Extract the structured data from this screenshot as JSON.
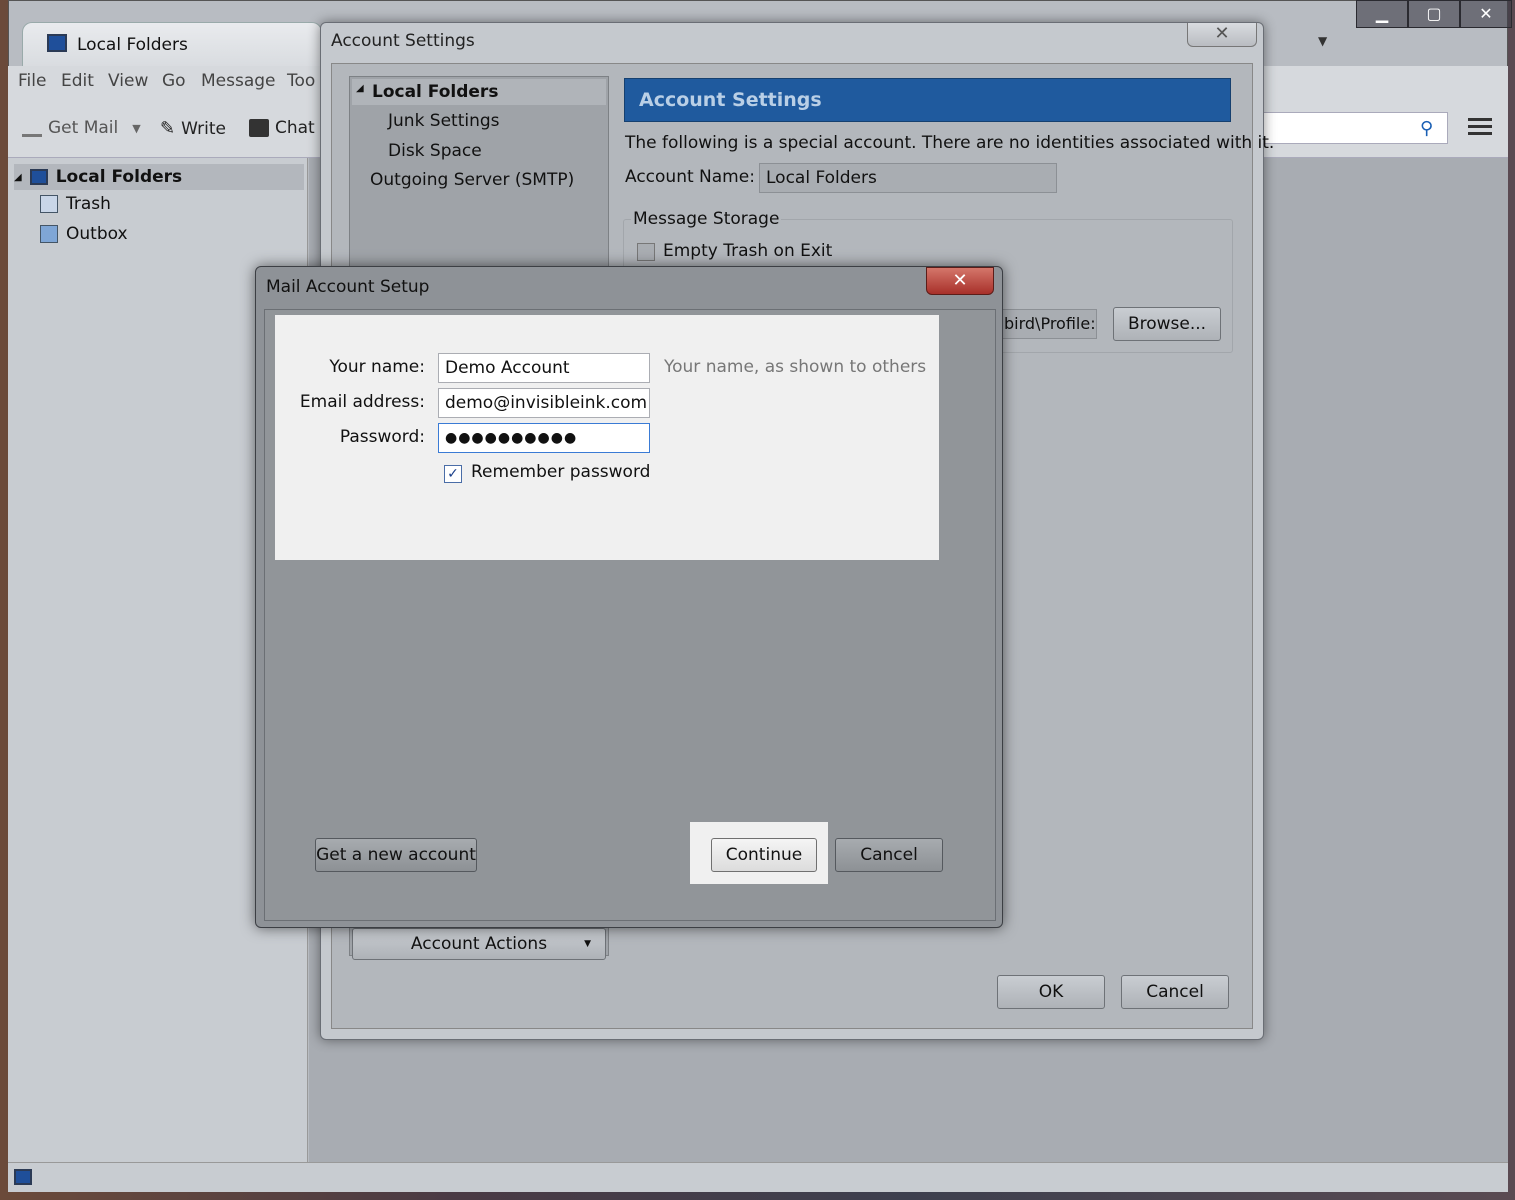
{
  "main_window": {
    "tab_title": "Local Folders",
    "menu": [
      "File",
      "Edit",
      "View",
      "Go",
      "Message",
      "Too"
    ],
    "toolbar": {
      "get_mail": "Get Mail",
      "write": "Write",
      "chat": "Chat"
    },
    "folders": {
      "account": "Local Folders",
      "trash": "Trash",
      "outbox": "Outbox"
    }
  },
  "account_settings": {
    "window_title": "Account Settings",
    "close_glyph": "✕",
    "tree": {
      "root": "Local Folders",
      "junk": "Junk Settings",
      "disk": "Disk Space",
      "smtp": "Outgoing Server (SMTP)"
    },
    "header": "Account Settings",
    "description": "The following is a special account. There are no identities associated with it.",
    "account_name_label": "Account Name:",
    "account_name_value": "Local Folders",
    "message_storage_label": "Message Storage",
    "empty_trash_label": "Empty Trash on Exit",
    "local_directory_value": "bird\\Profile:",
    "browse_label": "Browse...",
    "account_actions_label": "Account Actions",
    "ok_label": "OK",
    "cancel_label": "Cancel"
  },
  "mail_setup": {
    "title": "Mail Account Setup",
    "close_glyph": "✕",
    "your_name_label": "Your name:",
    "your_name_value": "Demo Account",
    "your_name_hint": "Your name, as shown to others",
    "email_label": "Email address:",
    "email_value": "demo@invisibleink.com",
    "password_label": "Password:",
    "password_value": "●●●●●●●●●●",
    "remember_checked": true,
    "remember_label": "Remember password",
    "get_new_account_label": "Get a new account",
    "continue_label": "Continue",
    "cancel_label": "Cancel"
  }
}
